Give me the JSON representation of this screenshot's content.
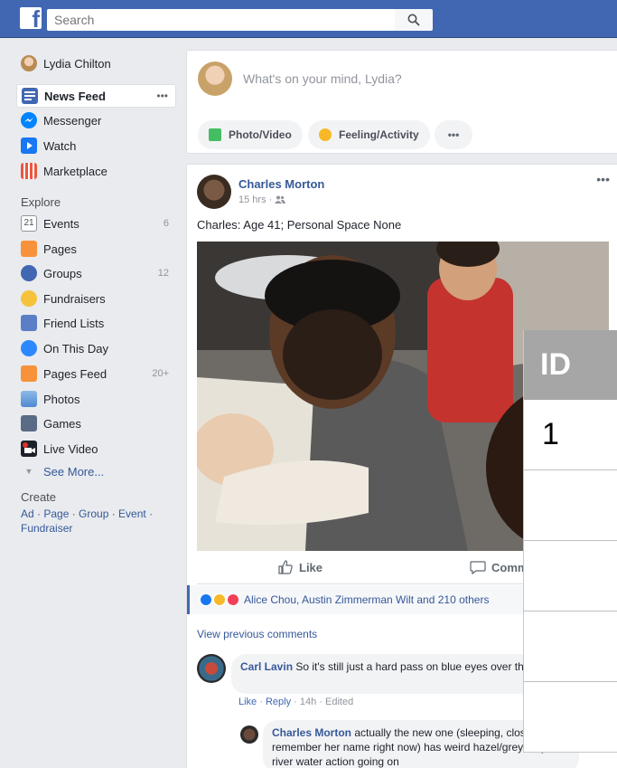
{
  "topbar": {
    "logo_letter": "f",
    "search_placeholder": "Search"
  },
  "sidebar": {
    "profile_name": "Lydia Chilton",
    "items": [
      {
        "label": "News Feed",
        "more": "•••"
      },
      {
        "label": "Messenger"
      },
      {
        "label": "Watch"
      },
      {
        "label": "Marketplace"
      }
    ],
    "explore_heading": "Explore",
    "explore": [
      {
        "label": "Events",
        "count": "6",
        "icon_text": "21"
      },
      {
        "label": "Pages"
      },
      {
        "label": "Groups",
        "count": "12"
      },
      {
        "label": "Fundraisers"
      },
      {
        "label": "Friend Lists"
      },
      {
        "label": "On This Day"
      },
      {
        "label": "Pages Feed",
        "count": "20+"
      },
      {
        "label": "Photos"
      },
      {
        "label": "Games"
      },
      {
        "label": "Live Video"
      }
    ],
    "see_more": "See More...",
    "create_heading": "Create",
    "create_links": "Ad · Page · Group · Event · Fundraiser"
  },
  "composer": {
    "placeholder": "What's on your mind, Lydia?",
    "photo_label": "Photo/Video",
    "feeling_label": "Feeling/Activity",
    "more_label": "•••"
  },
  "post": {
    "author": "Charles Morton",
    "time": "15 hrs ·",
    "more": "•••",
    "text": "Charles: Age 41; Personal Space None",
    "like_label": "Like",
    "comment_label": "Comm",
    "reactions_text": "Alice Chou, Austin Zimmerman Wilt and 210 others",
    "view_previous": "View previous comments",
    "comments": [
      {
        "author": "Carl Lavin",
        "text": " So it's still just a hard pass on blue eyes over then?",
        "actions": [
          "Like",
          "Reply"
        ],
        "meta": " · 14h · Edited"
      },
      {
        "author": "Charles Morton",
        "text": " actually the new one (sleeping, closed, can't remember her name right now) has weird hazel/grey/dirty river water action going on"
      }
    ]
  },
  "overlay_table": {
    "header": "ID",
    "rows": [
      "1",
      "",
      "",
      "",
      ""
    ]
  },
  "colors": {
    "brand": "#4267b2",
    "link": "#365899",
    "background": "#e9ebee"
  }
}
